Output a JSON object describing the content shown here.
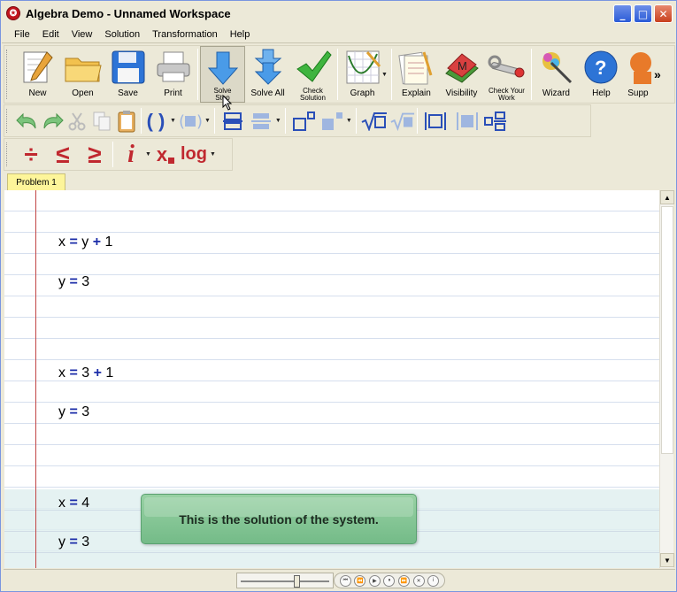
{
  "window": {
    "title": "Algebra Demo - Unnamed Workspace",
    "minimize": "_",
    "maximize": "□",
    "close": "✕"
  },
  "menu": [
    "File",
    "Edit",
    "View",
    "Solution",
    "Transformation",
    "Help"
  ],
  "toolbar_main": {
    "new": "New",
    "open": "Open",
    "save": "Save",
    "print": "Print",
    "solve_step": "Solve Step",
    "solve_all": "Solve All",
    "check_solution": "Check Solution",
    "graph": "Graph",
    "explain": "Explain",
    "visibility": "Visibility",
    "check_work": "Check Your Work",
    "wizard": "Wizard",
    "help": "Help",
    "support": "Supp",
    "overflow": "»"
  },
  "toolbar_row3": {
    "divide": "÷",
    "leq": "≤",
    "geq": "≥",
    "italic_i": "i",
    "subscript": "x",
    "log": "log"
  },
  "tabs": [
    "Problem 1"
  ],
  "equations": [
    {
      "lhs": "x",
      "op1": "=",
      "rhs1": "y",
      "op2": "+",
      "rhs2": "1"
    },
    {
      "lhs": "y",
      "op1": "=",
      "rhs1": "3"
    },
    {
      "lhs": "x",
      "op1": "=",
      "rhs1": "3",
      "op2": "+",
      "rhs2": "1"
    },
    {
      "lhs": "y",
      "op1": "=",
      "rhs1": "3"
    },
    {
      "lhs": "x",
      "op1": "=",
      "rhs1": "4"
    },
    {
      "lhs": "y",
      "op1": "=",
      "rhs1": "3"
    }
  ],
  "tooltip": "This is the solution of the system.",
  "colors": {
    "operator": "#1b2ca8",
    "tooltip_bg": "#7fc191",
    "tab_bg": "#fdf59a",
    "margin_line": "#c24545"
  }
}
